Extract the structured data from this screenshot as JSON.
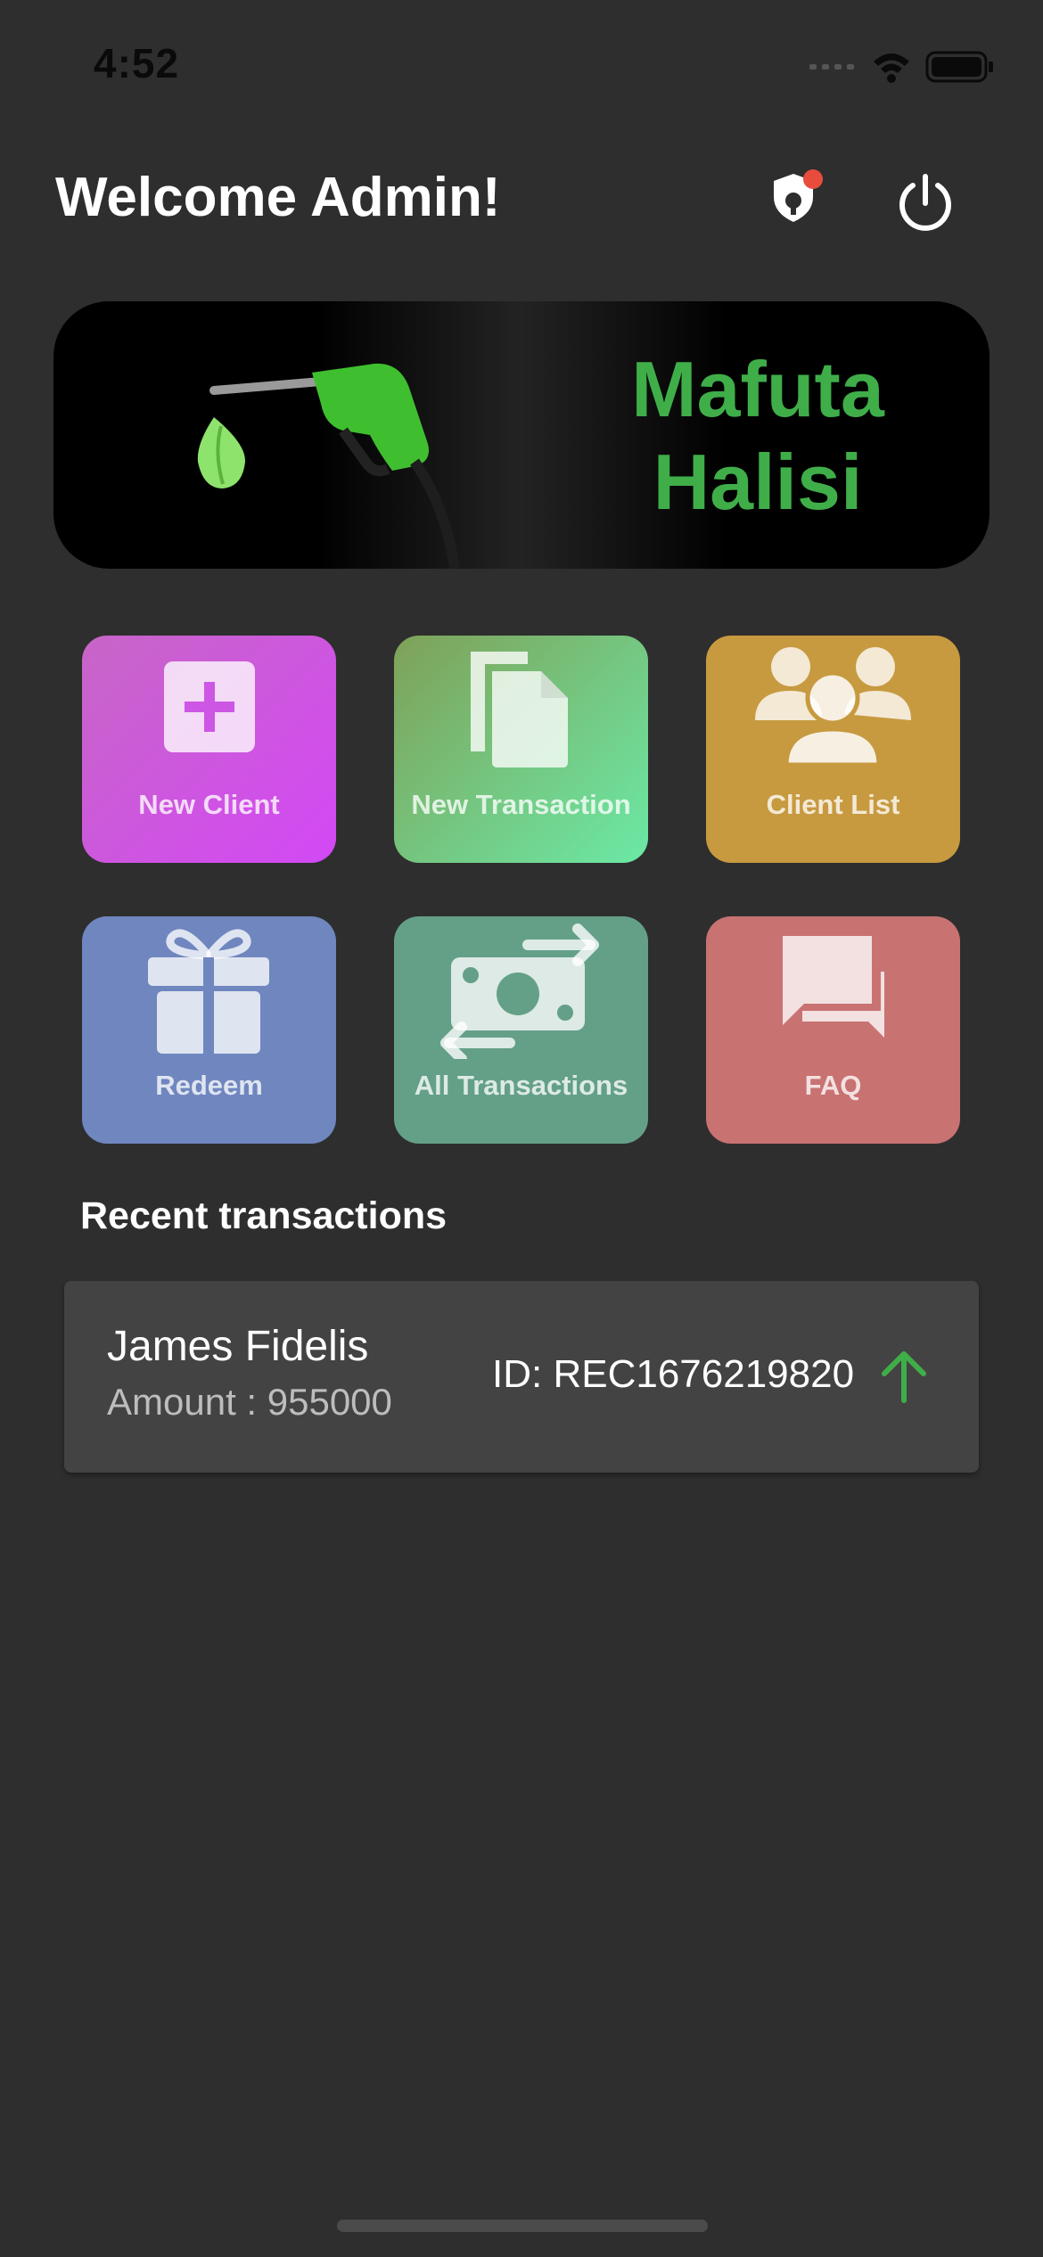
{
  "status_bar": {
    "time": "4:52",
    "icons": [
      "signal-icon",
      "wifi-icon",
      "battery-icon"
    ]
  },
  "header": {
    "title": "Welcome Admin!",
    "alert_icon": "shield-alert-icon",
    "power_icon": "power-icon"
  },
  "banner": {
    "line1": "Mafuta",
    "line2": "Halisi",
    "brand_color": "#3fae49"
  },
  "tiles": [
    {
      "label": "New Client",
      "icon": "plus-square-icon",
      "color": "#d04ee0"
    },
    {
      "label": "New Transaction",
      "icon": "copy-document-icon",
      "color": "#6fd39a"
    },
    {
      "label": "Client List",
      "icon": "users-group-icon",
      "color": "#c79a40"
    },
    {
      "label": "Redeem",
      "icon": "gift-icon",
      "color": "#6f86bf"
    },
    {
      "label": "All Transactions",
      "icon": "money-exchange-icon",
      "color": "#64a088"
    },
    {
      "label": "FAQ",
      "icon": "chat-bubbles-icon",
      "color": "#c97272"
    }
  ],
  "recent": {
    "title": "Recent transactions",
    "items": [
      {
        "name": "James Fidelis",
        "amount": "Amount : 955000",
        "id": "ID: REC1676219820",
        "direction_icon": "arrow-up-icon"
      }
    ]
  }
}
